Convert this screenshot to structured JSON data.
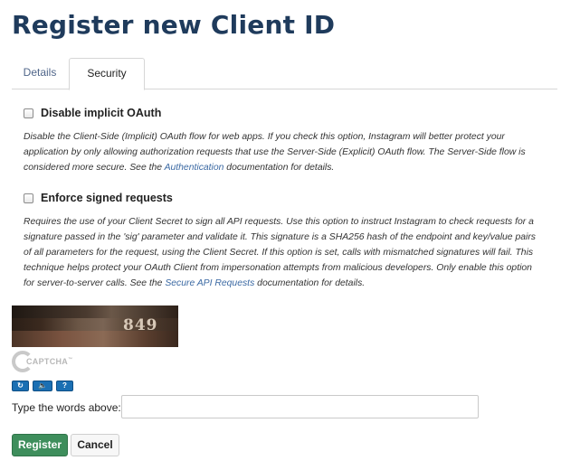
{
  "page": {
    "title": "Register new Client ID"
  },
  "tabs": [
    {
      "label": "Details",
      "active": false
    },
    {
      "label": "Security",
      "active": true
    }
  ],
  "options": {
    "implicit": {
      "label": "Disable implicit OAuth",
      "checked": false,
      "desc_before": "Disable the Client-Side (Implicit) OAuth flow for web apps. If you check this option, Instagram will better protect your application by only allowing authorization requests that use the Server-Side (Explicit) OAuth flow. The Server-Side flow is considered more secure. See the ",
      "link": "Authentication",
      "desc_after": " documentation for details."
    },
    "signed": {
      "label": "Enforce signed requests",
      "checked": false,
      "desc_before": "Requires the use of your Client Secret to sign all API requests. Use this option to instruct Instagram to check requests for a signature passed in the 'sig' parameter and validate it. This signature is a SHA256 hash of the endpoint and key/value pairs of all parameters for the request, using the Client Secret. If this option is set, calls with mismatched signatures will fail. This technique helps protect your OAuth Client from impersonation attempts from malicious developers. Only enable this option for server-to-server calls. See the ",
      "link": "Secure API Requests",
      "desc_after": " documentation for details."
    }
  },
  "captcha": {
    "image_text": "849",
    "logo_text": "CAPTCHA",
    "logo_tm": "™",
    "buttons": {
      "refresh": {
        "icon": "refresh-icon",
        "glyph": "↻"
      },
      "audio": {
        "icon": "speaker-icon",
        "glyph": "🔈"
      },
      "help": {
        "icon": "help-icon",
        "glyph": "?"
      }
    },
    "input_label": "Type the words above:",
    "input_value": "",
    "input_placeholder": ""
  },
  "actions": {
    "register_label": "Register",
    "cancel_label": "Cancel"
  },
  "colors": {
    "title": "#1f3b5c",
    "link": "#3b69a3",
    "register_bg": "#3e8e5c",
    "captcha_button": "#1a6fb3"
  }
}
